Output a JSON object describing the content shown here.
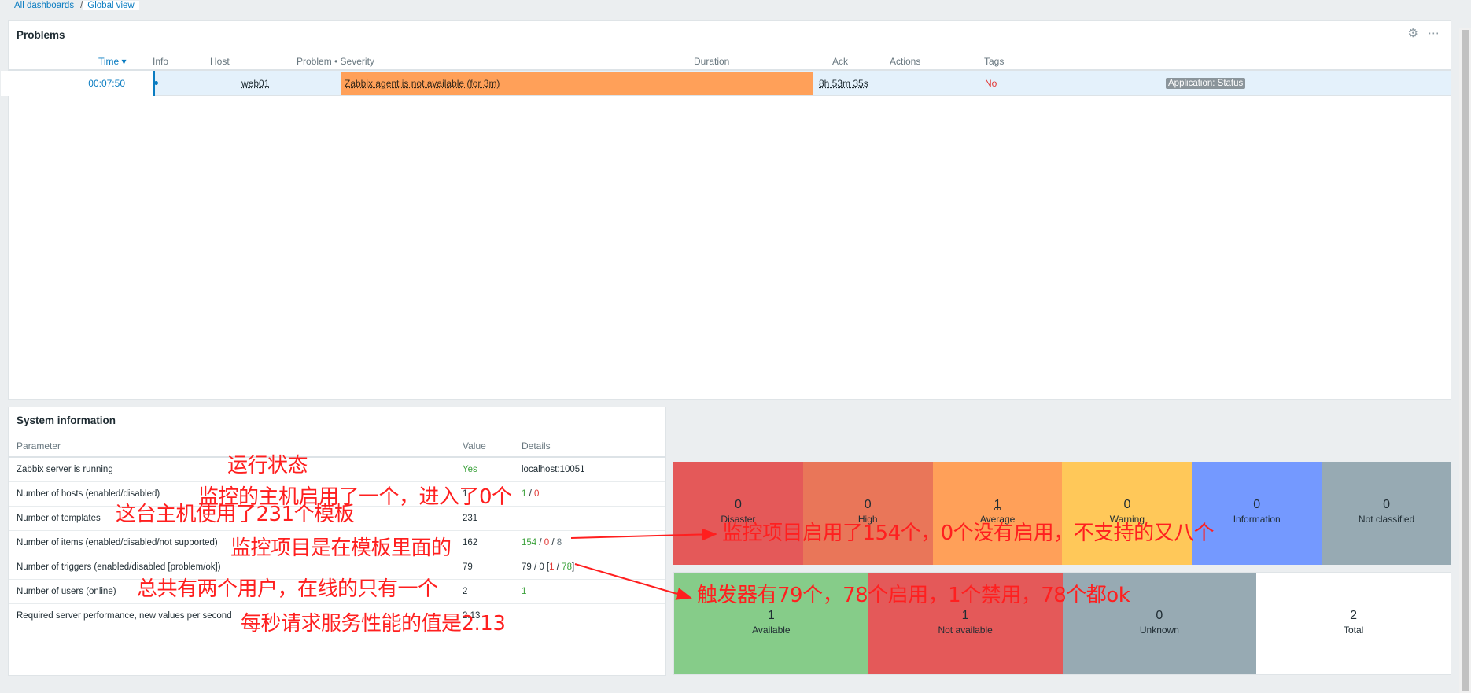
{
  "breadcrumb": {
    "all": "All dashboards",
    "sep": "/",
    "current": "Global view"
  },
  "problems": {
    "title": "Problems",
    "headers": {
      "time": "Time ▾",
      "info": "Info",
      "host": "Host",
      "problem": "Problem • Severity",
      "duration": "Duration",
      "ack": "Ack",
      "actions": "Actions",
      "tags": "Tags"
    },
    "row": {
      "time": "00:07:50",
      "host": "web01",
      "problem": "Zabbix agent is not available (for 3m)",
      "duration": "8h 53m 35s",
      "ack": "No",
      "tag": "Application: Status"
    },
    "icons": {
      "settings": "gear-icon",
      "more": "ellipsis-icon"
    }
  },
  "sysinfo": {
    "title": "System information",
    "headers": {
      "param": "Parameter",
      "value": "Value",
      "details": "Details"
    },
    "rows": [
      {
        "param": "Zabbix server is running",
        "value": "Yes",
        "details": "localhost:10051"
      },
      {
        "param": "Number of hosts (enabled/disabled)",
        "value": "1",
        "d1": "1",
        "dsep": " / ",
        "d2": "0"
      },
      {
        "param": "Number of templates",
        "value": "231",
        "details": ""
      },
      {
        "param": "Number of items (enabled/disabled/not supported)",
        "value": "162",
        "d1": "154",
        "d2": "0",
        "d3": "8",
        "sep": " / "
      },
      {
        "param": "Number of triggers (enabled/disabled [problem/ok])",
        "value": "79",
        "prefix": "79 / 0 [",
        "p": "1",
        "slash": " / ",
        "ok": "78",
        "suffix": "]"
      },
      {
        "param": "Number of users (online)",
        "value": "2",
        "details": "1"
      },
      {
        "param": "Required server performance, new values per second",
        "value": "2.13",
        "details": ""
      }
    ]
  },
  "severity": [
    {
      "count": "0",
      "label": "Disaster",
      "color": "#e45959"
    },
    {
      "count": "0",
      "label": "High",
      "color": "#e97659"
    },
    {
      "count": "1",
      "label": "Average",
      "color": "#ffa059"
    },
    {
      "count": "0",
      "label": "Warning",
      "color": "#ffc859"
    },
    {
      "count": "0",
      "label": "Information",
      "color": "#7499ff"
    },
    {
      "count": "0",
      "label": "Not classified",
      "color": "#97aab3"
    }
  ],
  "hosts": [
    {
      "count": "1",
      "label": "Available",
      "color": "#86cc89"
    },
    {
      "count": "1",
      "label": "Not available",
      "color": "#e45959"
    },
    {
      "count": "0",
      "label": "Unknown",
      "color": "#97aab3"
    },
    {
      "count": "2",
      "label": "Total",
      "color": "#ffffff"
    }
  ],
  "annotations": {
    "running": "运行状态",
    "hosts": "监控的主机启用了一个，进入了0个",
    "templates": "这台主机使用了231个模板",
    "items": "监控项目是在模板里面的",
    "items_arrow": "监控项目启用了154个，0个没有启用，不支持的又八个",
    "triggers_arrow": "触发器有79个，78个启用，1个禁用，78个都ok",
    "users": "总共有两个用户，在线的只有一个",
    "perf": "每秒请求服务性能的值是2.13"
  }
}
